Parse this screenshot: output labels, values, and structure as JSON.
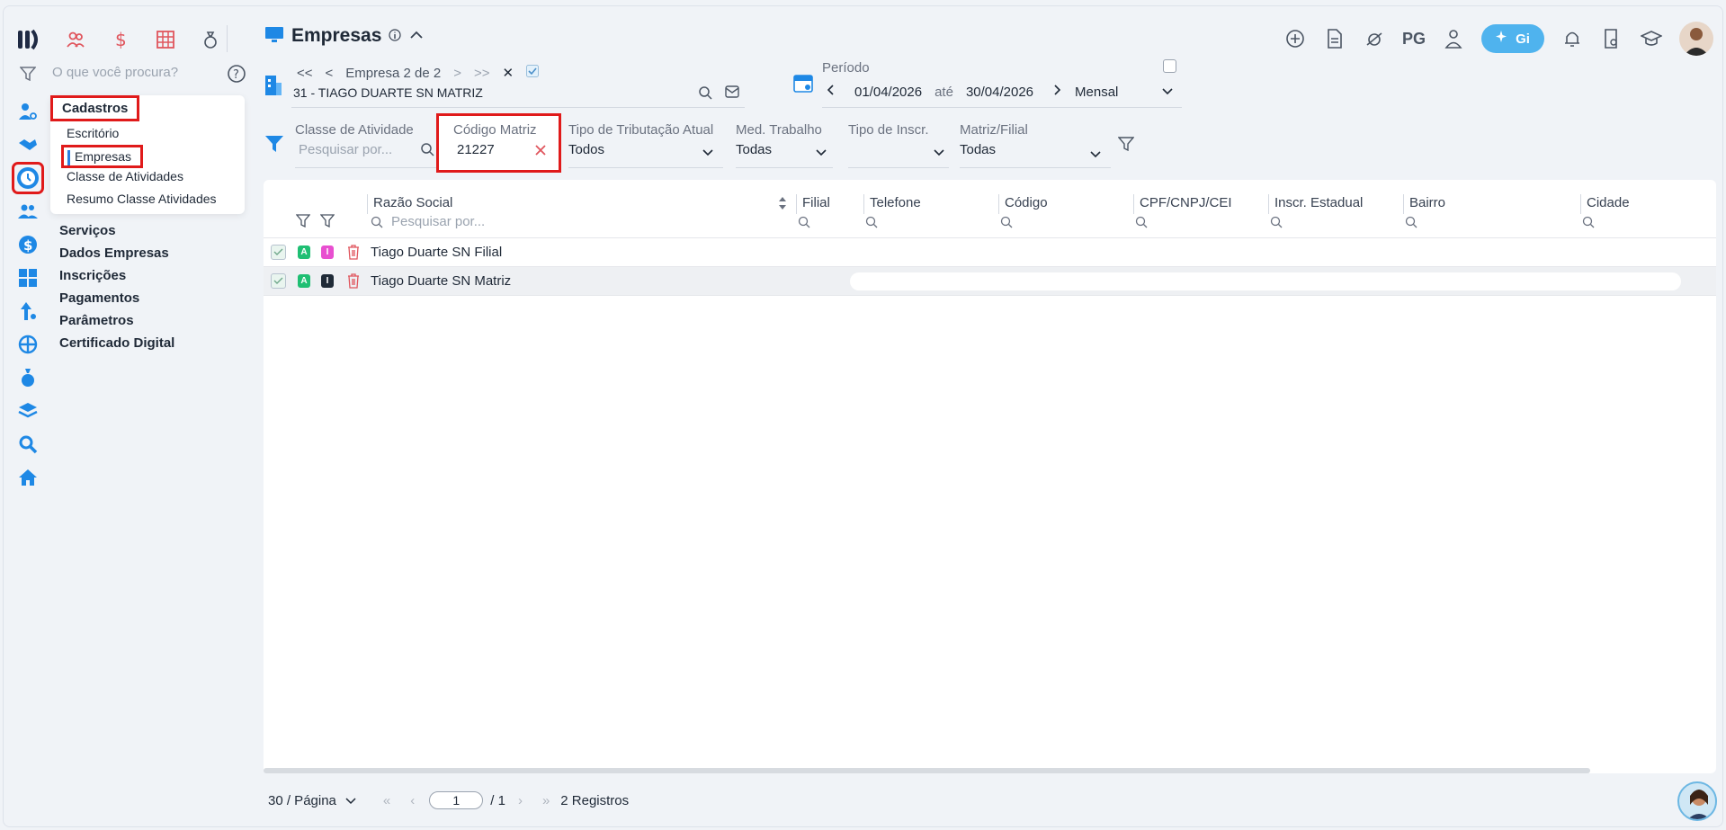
{
  "app": {
    "search_placeholder": "O que você procura?"
  },
  "header": {
    "title": "Empresas",
    "right_pg": "PG",
    "gi_label": "Gi"
  },
  "menu": {
    "title": "Cadastros",
    "items": [
      "Escritório",
      "Empresas",
      "Classe de Atividades",
      "Resumo Classe Atividades"
    ],
    "sections": [
      "Serviços",
      "Dados Empresas",
      "Inscrições",
      "Pagamentos",
      "Parâmetros",
      "Certificado Digital"
    ]
  },
  "empresa_nav": {
    "first": "<<",
    "prev": "<",
    "label": "Empresa",
    "current": "2",
    "of": "de",
    "total": "2",
    "next": ">",
    "last": ">>",
    "close": "✕",
    "selected_company": "31 - TIAGO DUARTE SN MATRIZ"
  },
  "periodo": {
    "label": "Período",
    "start": "01/04/2026",
    "until": "até",
    "end": "30/04/2026",
    "granularity": "Mensal"
  },
  "filters": {
    "classe": {
      "label": "Classe de Atividade",
      "placeholder": "Pesquisar por..."
    },
    "codigo_matriz": {
      "label": "Código Matriz",
      "value": "21227"
    },
    "tributacao": {
      "label": "Tipo de Tributação Atual",
      "value": "Todos"
    },
    "med_trabalho": {
      "label": "Med. Trabalho",
      "value": "Todas"
    },
    "tipo_inscr": {
      "label": "Tipo de Inscr.",
      "value": ""
    },
    "matriz_filial": {
      "label": "Matriz/Filial",
      "value": "Todas"
    }
  },
  "table": {
    "columns": [
      "Razão Social",
      "Filial",
      "Telefone",
      "Código",
      "CPF/CNPJ/CEI",
      "Inscr. Estadual",
      "Bairro",
      "Cidade"
    ],
    "search_placeholder": "Pesquisar por...",
    "rows": [
      {
        "badge_a": "A",
        "badge_b": "I",
        "name": "Tiago Duarte SN Filial"
      },
      {
        "badge_a": "A",
        "badge_b": "I",
        "name": "Tiago Duarte SN Matriz"
      }
    ]
  },
  "footer": {
    "per_page": "30 / Página",
    "page": "1",
    "page_total": "/ 1",
    "records": "2 Registros"
  },
  "colors": {
    "accent": "#4fb3ee",
    "highlight_border": "#e01a1a",
    "rail_blue": "#1e88e5",
    "top_icon_red": "#e0555d",
    "badge_green": "#1fbf73",
    "badge_pink": "#e84fd0",
    "badge_dark": "#1f2a37"
  }
}
